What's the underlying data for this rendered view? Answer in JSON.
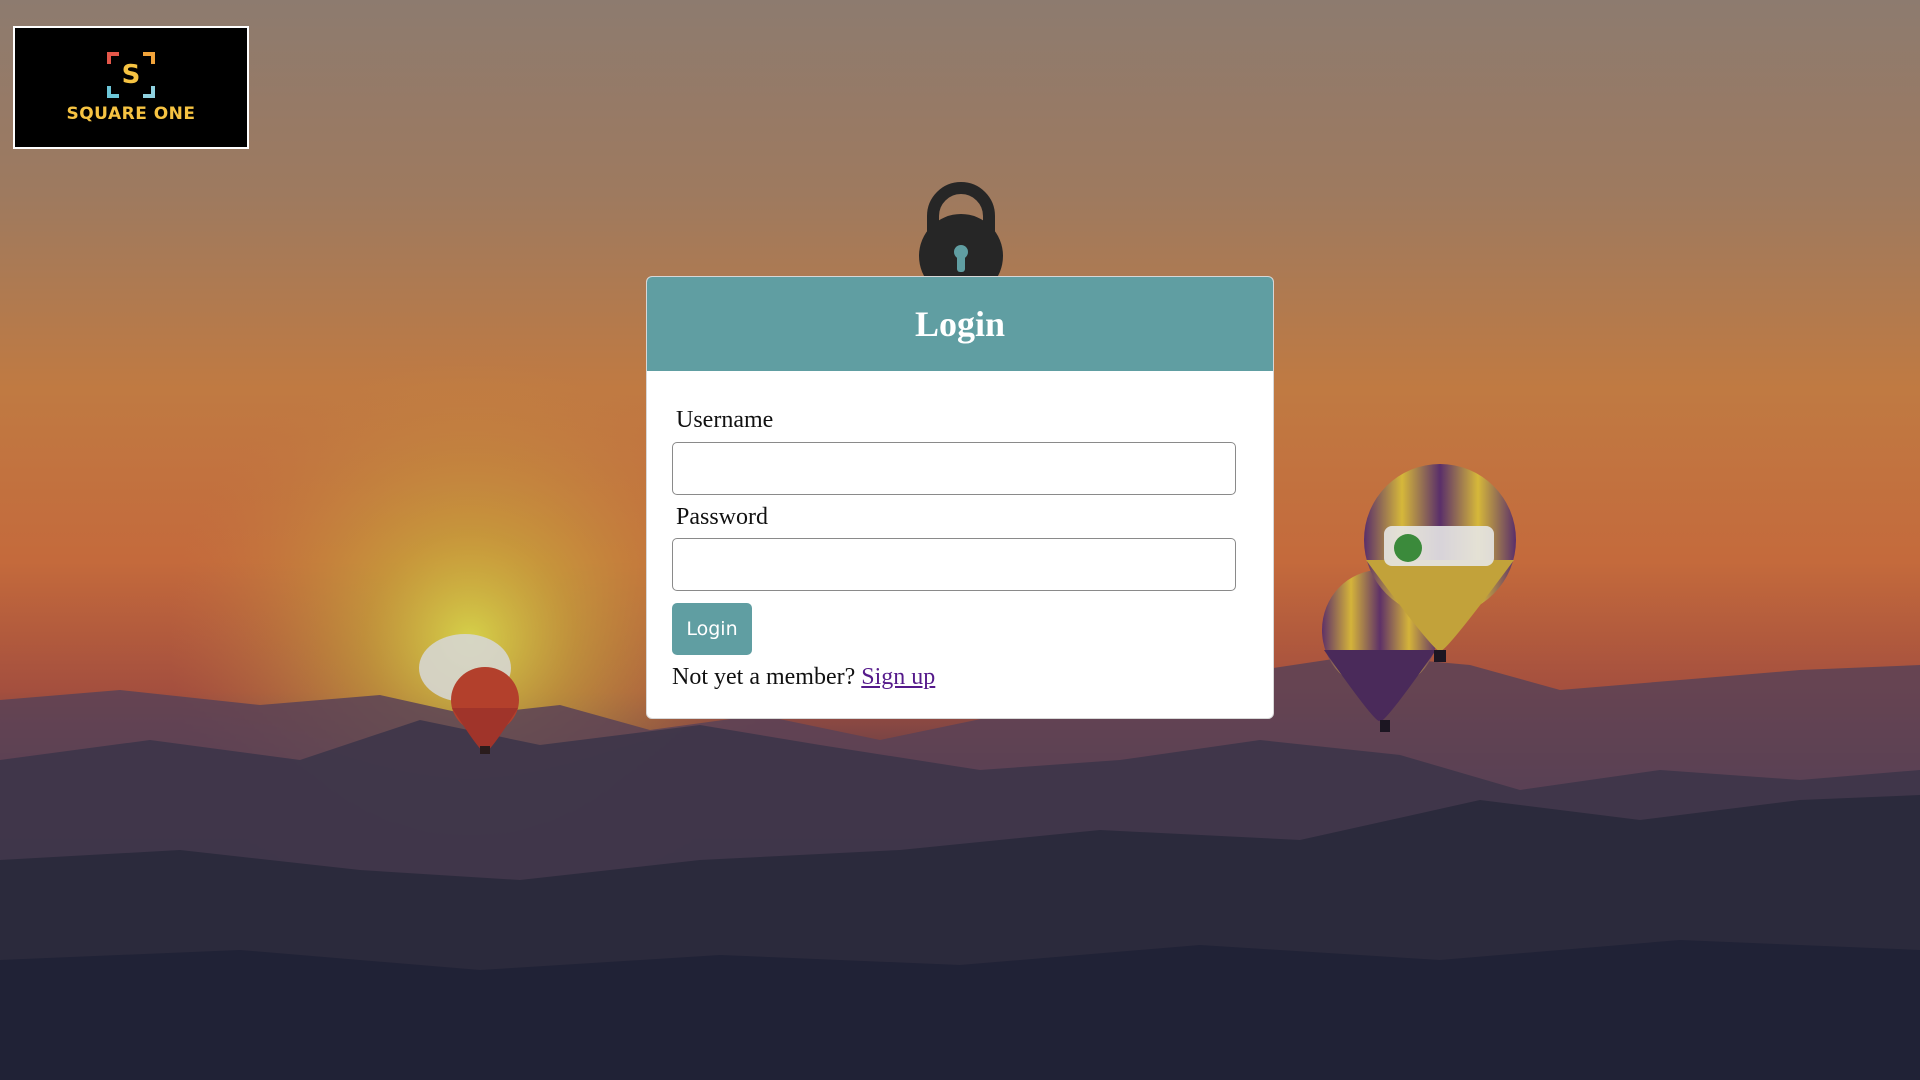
{
  "background": {
    "description_icon": "sunset-hot-air-balloons-background",
    "sky_top": "#8f7a6c",
    "sky_mid": "#c97a3c",
    "sun_glow": "#c9c23a",
    "mountains": "#2c2b3f"
  },
  "logo": {
    "mark_letter": "S",
    "text": "SQUARE ONE",
    "text_color": "#f6c342"
  },
  "login_card": {
    "title": "Login",
    "header_color": "#609ea2",
    "username_label": "Username",
    "username_value": "",
    "password_label": "Password",
    "password_value": "",
    "button_label": "Login",
    "signup_prompt": "Not yet a member?",
    "signup_link": "Sign up"
  },
  "icons": {
    "lock": "lock-icon"
  }
}
